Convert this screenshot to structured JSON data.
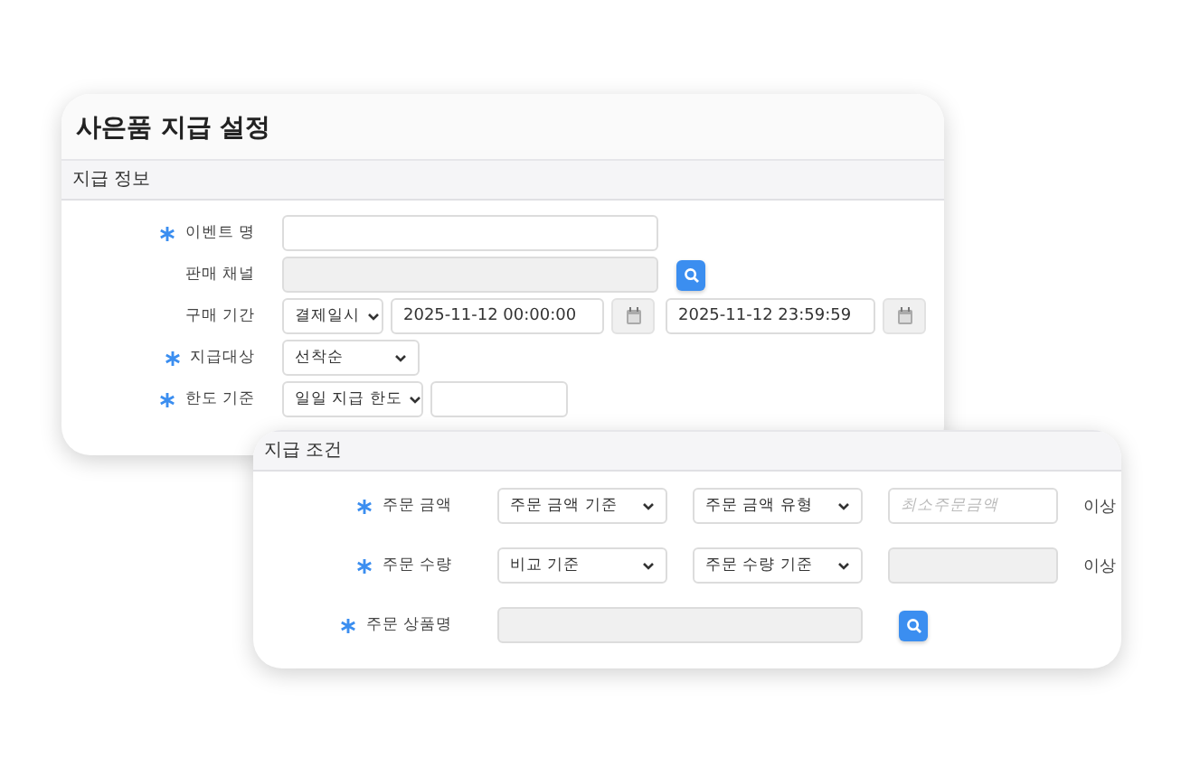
{
  "title": "사은품 지급 설정",
  "sections": [
    {
      "header": "지급 정보",
      "rows": [
        {
          "required": true,
          "label": "이벤트 명",
          "controls": [
            {
              "kind": "text",
              "disabled": false
            }
          ]
        },
        {
          "required": false,
          "label": "판매 채널",
          "controls": [
            {
              "kind": "text",
              "disabled": true
            },
            {
              "kind": "search-button"
            }
          ]
        },
        {
          "required": false,
          "label": "구매 기간",
          "controls": [
            {
              "kind": "select",
              "value": "결제일시"
            },
            {
              "kind": "date",
              "value": "2025-11-12 00:00:00"
            },
            {
              "kind": "calendar-button"
            },
            {
              "kind": "date",
              "value": "2025-11-12 23:59:59"
            },
            {
              "kind": "calendar-button"
            }
          ]
        },
        {
          "required": true,
          "label": "지급대상",
          "controls": [
            {
              "kind": "select",
              "value": "선착순"
            }
          ]
        },
        {
          "required": true,
          "label": "한도 기준",
          "controls": [
            {
              "kind": "select",
              "value": "일일 지급 한도"
            },
            {
              "kind": "text",
              "disabled": false
            }
          ]
        }
      ]
    },
    {
      "header": "지급 조건",
      "rows": [
        {
          "required": true,
          "label": "주문 금액",
          "controls": [
            {
              "kind": "select",
              "value": "주문 금액 기준"
            },
            {
              "kind": "select",
              "value": "주문 금액 유형"
            },
            {
              "kind": "text",
              "disabled": false,
              "placeholder": "최소주문금액"
            },
            {
              "kind": "suffix",
              "value": "이상"
            }
          ]
        },
        {
          "required": true,
          "label": "주문 수량",
          "controls": [
            {
              "kind": "select",
              "value": "비교 기준"
            },
            {
              "kind": "select",
              "value": "주문 수량 기준"
            },
            {
              "kind": "text",
              "disabled": true
            },
            {
              "kind": "suffix",
              "value": "이상"
            }
          ]
        },
        {
          "required": true,
          "label": "주문 상품명",
          "controls": [
            {
              "kind": "text",
              "disabled": true
            },
            {
              "kind": "search-button"
            }
          ]
        }
      ]
    }
  ]
}
